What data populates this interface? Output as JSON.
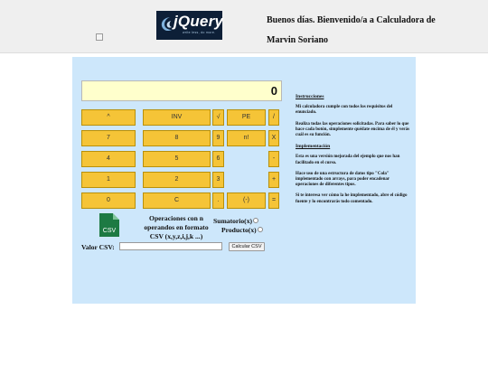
{
  "header": {
    "logo": {
      "text": "jQuery",
      "subtext": "write less, do more.",
      "icon": "jquery-swirl-icon"
    },
    "greeting_line1": "Buenos días. Bienvenido/a a Calculadora de",
    "greeting_line2": "Marvin Soriano"
  },
  "display": {
    "value": "0"
  },
  "keys": [
    {
      "label": "^"
    },
    {
      "label": "INV"
    },
    {
      "label": "√"
    },
    {
      "label": "PE"
    },
    {
      "label": "/"
    },
    {
      "label": "7"
    },
    {
      "label": "8"
    },
    {
      "label": "9"
    },
    {
      "label": "n!"
    },
    {
      "label": "X"
    },
    {
      "label": "4"
    },
    {
      "label": "5"
    },
    {
      "label": "6"
    },
    {
      "label": "-"
    },
    {
      "label": "1"
    },
    {
      "label": "2"
    },
    {
      "label": "3"
    },
    {
      "label": "+"
    },
    {
      "label": "0"
    },
    {
      "label": "C"
    },
    {
      "label": "."
    },
    {
      "label": "(-)"
    },
    {
      "label": "="
    }
  ],
  "csv_section": {
    "icon_label": "CSV",
    "ops_line1": "Operaciones con n",
    "ops_line2": "operandos en formato",
    "ops_line3": "CSV (x,y,z,i,j,k ...)",
    "sum_label": "Sumatorio(x)",
    "product_label": "Producto(x)",
    "input_label": "Valor CSV:",
    "input_value": "",
    "button_label": "Calcular CSV"
  },
  "info": {
    "heading1": "Instrucciones",
    "p1": "Mi calculadora cumple con todos los requisitos del enunciado.",
    "p2": "Realiza todas las operaciones solicitadas. Para saber lo que hace cada botón, simplemente quédate encima de él y verás cuál es su función.",
    "heading2": "Implementación",
    "p3": "Esta es una versión mejorada del ejemplo que nos han facilitado en el curso.",
    "p4": "Hace uso de una estructura de datos tipo \"Cola\" implementado con arrays, para poder encadenar operaciones de diferentes tipos.",
    "p5": "Si te interesa ver cómo la he implementado, abre el código fuente y lo encontrarás todo comentado."
  },
  "colors": {
    "header_bg": "#efefef",
    "panel_bg": "#cde7fb",
    "display_bg": "#ffffcc",
    "key_bg": "#f5c437",
    "logo_bg": "#0d1f37",
    "csv_icon": "#1d7a43"
  }
}
